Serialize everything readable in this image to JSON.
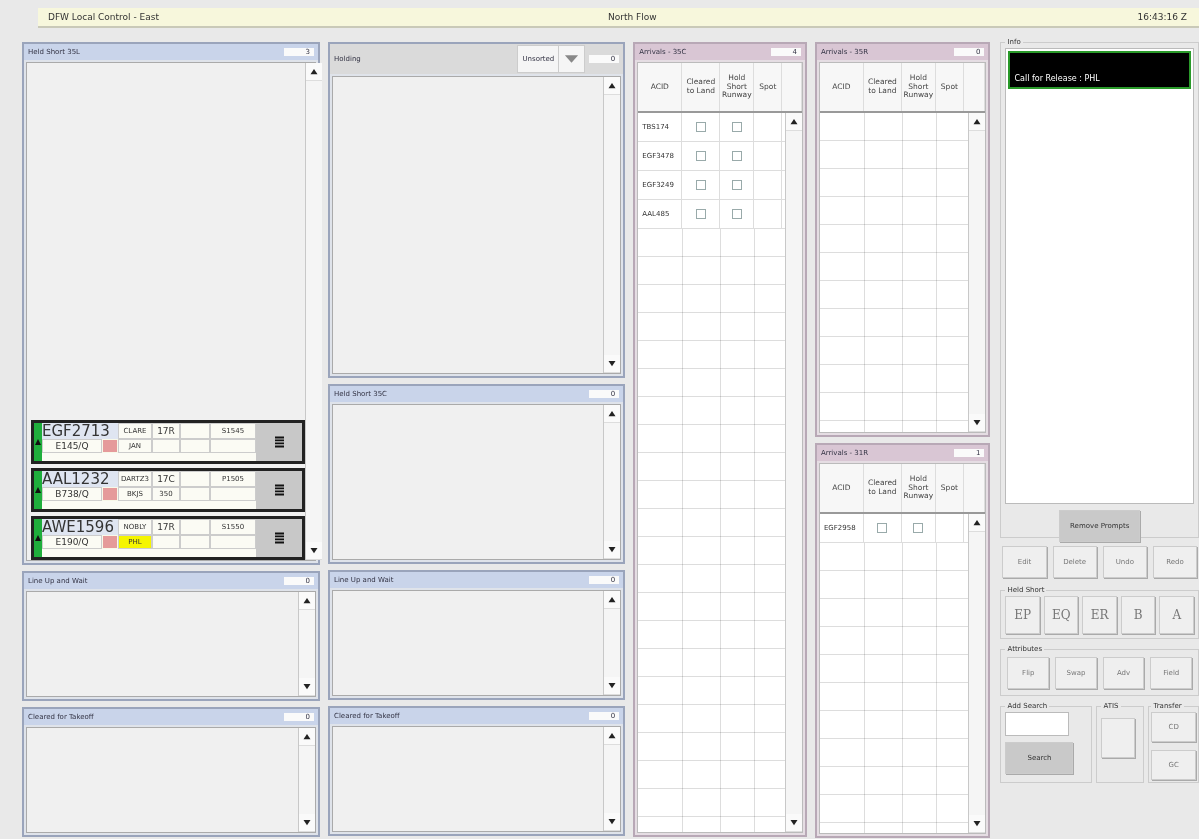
{
  "title_bar": {
    "position": "DFW Local Control - East",
    "flow": "North Flow",
    "time": "16:43:16 Z"
  },
  "departure_columns": [
    [
      {
        "kind": "list",
        "title": "Held Short 35L",
        "count": "3",
        "strips": [
          {
            "callsign": "EGF2713",
            "aircraft_type": "E145/Q",
            "fix": "CLARE",
            "runway": "17R",
            "time": "S1545",
            "destination": "JAN",
            "destination_highlighted": false
          },
          {
            "callsign": "AAL1232",
            "aircraft_type": "B738/Q",
            "fix": "DARTZ3",
            "runway": "17C",
            "time": "P1505",
            "destination": "BKJS",
            "altitude": "350",
            "destination_highlighted": false
          },
          {
            "callsign": "AWE1596",
            "aircraft_type": "E190/Q",
            "fix": "NOBLY",
            "runway": "17R",
            "time": "S1550",
            "destination": "PHL",
            "destination_highlighted": true
          }
        ]
      },
      {
        "kind": "list",
        "title": "Line Up and Wait",
        "count": "0"
      },
      {
        "kind": "list",
        "title": "Cleared for Takeoff",
        "count": "0"
      }
    ],
    [
      {
        "kind": "holding",
        "title": "Holding",
        "count": "0",
        "sort": "Unsorted"
      },
      {
        "kind": "list",
        "title": "Held Short 35C",
        "count": "0"
      },
      {
        "kind": "list",
        "title": "Line Up and Wait",
        "count": "0"
      },
      {
        "kind": "list",
        "title": "Cleared for Takeoff",
        "count": "0"
      }
    ]
  ],
  "arrival_columns": [
    [
      {
        "title": "Arrivals - 35C",
        "count": "4",
        "headers": [
          "ACID",
          "Cleared to Land",
          "Hold Short Runway",
          "Spot"
        ],
        "rows": [
          {
            "acid": "TBS174",
            "cleared_to_land": false,
            "hold_short_runway": false
          },
          {
            "acid": "EGF3478",
            "cleared_to_land": false,
            "hold_short_runway": false
          },
          {
            "acid": "EGF3249",
            "cleared_to_land": false,
            "hold_short_runway": false
          },
          {
            "acid": "AAL485",
            "cleared_to_land": false,
            "hold_short_runway": false
          }
        ]
      }
    ],
    [
      {
        "title": "Arrivals - 35R",
        "count": "0",
        "headers": [
          "ACID",
          "Cleared to Land",
          "Hold Short Runway",
          "Spot"
        ]
      },
      {
        "title": "Arrivals - 31R",
        "count": "1",
        "headers": [
          "ACID",
          "Cleared to Land",
          "Hold Short Runway",
          "Spot"
        ],
        "rows": [
          {
            "acid": "EGF2958",
            "cleared_to_land": false,
            "hold_short_runway": false
          }
        ]
      }
    ]
  ],
  "info": {
    "title": "Info",
    "prompts": [
      "Call for Release : PHL"
    ],
    "remove_button": "Remove Prompts"
  },
  "edit_buttons": [
    "Edit",
    "Delete",
    "Undo",
    "Redo"
  ],
  "held_short": {
    "title": "Held Short",
    "buttons": [
      "EP",
      "EQ",
      "ER",
      "B",
      "A"
    ]
  },
  "attributes": {
    "title": "Attributes",
    "buttons": [
      "Flip",
      "Swap",
      "Adv",
      "Field"
    ]
  },
  "add_search": {
    "title": "Add Search",
    "button": "Search"
  },
  "atis": {
    "title": "ATIS"
  },
  "transfer": {
    "title": "Transfer",
    "buttons": [
      "CD",
      "GC"
    ]
  }
}
